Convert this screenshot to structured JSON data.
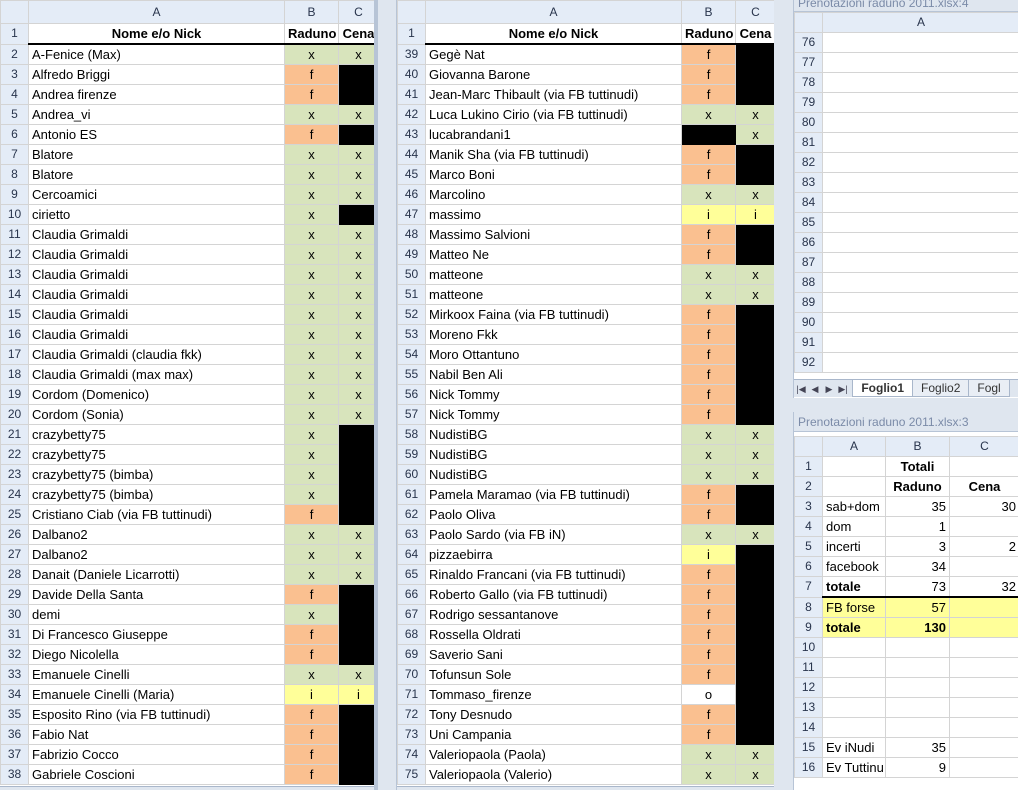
{
  "colors": {
    "green": "#d8e4bc",
    "orange": "#fac090",
    "black": "#000000",
    "yellow": "#ffff99",
    "header": "#e4ecf7"
  },
  "win1": {
    "col_headers": [
      "A",
      "B",
      "C"
    ],
    "header_row": {
      "num": "1",
      "cells": [
        "Nome e/o Nick",
        "Raduno",
        "Cena"
      ]
    },
    "rows": [
      {
        "num": "2",
        "name": "A-Fenice (Max)",
        "b": "x",
        "bc": "g",
        "c": "x",
        "cc": "g"
      },
      {
        "num": "3",
        "name": "Alfredo Briggi",
        "b": "f",
        "bc": "o",
        "c": "",
        "cc": "k"
      },
      {
        "num": "4",
        "name": "Andrea firenze",
        "b": "f",
        "bc": "o",
        "c": "",
        "cc": "k"
      },
      {
        "num": "5",
        "name": "Andrea_vi",
        "b": "x",
        "bc": "g",
        "c": "x",
        "cc": "g"
      },
      {
        "num": "6",
        "name": "Antonio ES",
        "b": "f",
        "bc": "o",
        "c": "",
        "cc": "k"
      },
      {
        "num": "7",
        "name": "Blatore",
        "b": "x",
        "bc": "g",
        "c": "x",
        "cc": "g"
      },
      {
        "num": "8",
        "name": "Blatore",
        "b": "x",
        "bc": "g",
        "c": "x",
        "cc": "g"
      },
      {
        "num": "9",
        "name": "Cercoamici",
        "b": "x",
        "bc": "g",
        "c": "x",
        "cc": "g"
      },
      {
        "num": "10",
        "name": "cirietto",
        "b": "x",
        "bc": "g",
        "c": "",
        "cc": "k"
      },
      {
        "num": "11",
        "name": "Claudia Grimaldi",
        "b": "x",
        "bc": "g",
        "c": "x",
        "cc": "g"
      },
      {
        "num": "12",
        "name": "Claudia Grimaldi",
        "b": "x",
        "bc": "g",
        "c": "x",
        "cc": "g"
      },
      {
        "num": "13",
        "name": "Claudia Grimaldi",
        "b": "x",
        "bc": "g",
        "c": "x",
        "cc": "g"
      },
      {
        "num": "14",
        "name": "Claudia Grimaldi",
        "b": "x",
        "bc": "g",
        "c": "x",
        "cc": "g"
      },
      {
        "num": "15",
        "name": "Claudia Grimaldi",
        "b": "x",
        "bc": "g",
        "c": "x",
        "cc": "g"
      },
      {
        "num": "16",
        "name": "Claudia Grimaldi",
        "b": "x",
        "bc": "g",
        "c": "x",
        "cc": "g"
      },
      {
        "num": "17",
        "name": "Claudia Grimaldi (claudia fkk)",
        "b": "x",
        "bc": "g",
        "c": "x",
        "cc": "g"
      },
      {
        "num": "18",
        "name": "Claudia Grimaldi (max max)",
        "b": "x",
        "bc": "g",
        "c": "x",
        "cc": "g"
      },
      {
        "num": "19",
        "name": "Cordom (Domenico)",
        "b": "x",
        "bc": "g",
        "c": "x",
        "cc": "g"
      },
      {
        "num": "20",
        "name": "Cordom (Sonia)",
        "b": "x",
        "bc": "g",
        "c": "x",
        "cc": "g"
      },
      {
        "num": "21",
        "name": "crazybetty75",
        "b": "x",
        "bc": "g",
        "c": "",
        "cc": "k"
      },
      {
        "num": "22",
        "name": "crazybetty75",
        "b": "x",
        "bc": "g",
        "c": "",
        "cc": "k"
      },
      {
        "num": "23",
        "name": "crazybetty75 (bimba)",
        "b": "x",
        "bc": "g",
        "c": "",
        "cc": "k"
      },
      {
        "num": "24",
        "name": "crazybetty75 (bimba)",
        "b": "x",
        "bc": "g",
        "c": "",
        "cc": "k"
      },
      {
        "num": "25",
        "name": "Cristiano Ciab (via FB tuttinudi)",
        "b": "f",
        "bc": "o",
        "c": "",
        "cc": "k"
      },
      {
        "num": "26",
        "name": "Dalbano2",
        "b": "x",
        "bc": "g",
        "c": "x",
        "cc": "g"
      },
      {
        "num": "27",
        "name": "Dalbano2",
        "b": "x",
        "bc": "g",
        "c": "x",
        "cc": "g"
      },
      {
        "num": "28",
        "name": "Danait (Daniele Licarrotti)",
        "b": "x",
        "bc": "g",
        "c": "x",
        "cc": "g"
      },
      {
        "num": "29",
        "name": "Davide Della Santa",
        "b": "f",
        "bc": "o",
        "c": "",
        "cc": "k"
      },
      {
        "num": "30",
        "name": "demi",
        "b": "x",
        "bc": "g",
        "c": "",
        "cc": "k"
      },
      {
        "num": "31",
        "name": "Di Francesco Giuseppe",
        "b": "f",
        "bc": "o",
        "c": "",
        "cc": "k"
      },
      {
        "num": "32",
        "name": "Diego Nicolella",
        "b": "f",
        "bc": "o",
        "c": "",
        "cc": "k"
      },
      {
        "num": "33",
        "name": "Emanuele Cinelli",
        "b": "x",
        "bc": "g",
        "c": "x",
        "cc": "g"
      },
      {
        "num": "34",
        "name": "Emanuele Cinelli (Maria)",
        "b": "i",
        "bc": "y",
        "c": "i",
        "cc": "y"
      },
      {
        "num": "35",
        "name": "Esposito Rino (via FB tuttinudi)",
        "b": "f",
        "bc": "o",
        "c": "",
        "cc": "k"
      },
      {
        "num": "36",
        "name": "Fabio Nat",
        "b": "f",
        "bc": "o",
        "c": "",
        "cc": "k"
      },
      {
        "num": "37",
        "name": "Fabrizio Cocco",
        "b": "f",
        "bc": "o",
        "c": "",
        "cc": "k"
      },
      {
        "num": "38",
        "name": "Gabriele Coscioni",
        "b": "f",
        "bc": "o",
        "c": "",
        "cc": "k"
      }
    ]
  },
  "win2": {
    "col_headers": [
      "A",
      "B",
      "C"
    ],
    "header_row": {
      "num": "1",
      "cells": [
        "Nome e/o Nick",
        "Raduno",
        "Cena"
      ]
    },
    "rows": [
      {
        "num": "39",
        "name": "Gegè Nat",
        "b": "f",
        "bc": "o",
        "c": "",
        "cc": "k"
      },
      {
        "num": "40",
        "name": "Giovanna Barone",
        "b": "f",
        "bc": "o",
        "c": "",
        "cc": "k"
      },
      {
        "num": "41",
        "name": "Jean-Marc Thibault (via FB tuttinudi)",
        "b": "f",
        "bc": "o",
        "c": "",
        "cc": "k"
      },
      {
        "num": "42",
        "name": "Luca Lukino Cirio (via FB tuttinudi)",
        "b": "x",
        "bc": "g",
        "c": "x",
        "cc": "g"
      },
      {
        "num": "43",
        "name": "lucabrandani1",
        "b": "",
        "bc": "k",
        "c": "x",
        "cc": "g"
      },
      {
        "num": "44",
        "name": "Manik Sha (via FB tuttinudi)",
        "b": "f",
        "bc": "o",
        "c": "",
        "cc": "k"
      },
      {
        "num": "45",
        "name": "Marco Boni",
        "b": "f",
        "bc": "o",
        "c": "",
        "cc": "k"
      },
      {
        "num": "46",
        "name": "Marcolino",
        "b": "x",
        "bc": "g",
        "c": "x",
        "cc": "g"
      },
      {
        "num": "47",
        "name": "massimo",
        "b": "i",
        "bc": "y",
        "c": "i",
        "cc": "y"
      },
      {
        "num": "48",
        "name": "Massimo Salvioni",
        "b": "f",
        "bc": "o",
        "c": "",
        "cc": "k"
      },
      {
        "num": "49",
        "name": "Matteo Ne",
        "b": "f",
        "bc": "o",
        "c": "",
        "cc": "k"
      },
      {
        "num": "50",
        "name": "matteone",
        "b": "x",
        "bc": "g",
        "c": "x",
        "cc": "g"
      },
      {
        "num": "51",
        "name": "matteone",
        "b": "x",
        "bc": "g",
        "c": "x",
        "cc": "g"
      },
      {
        "num": "52",
        "name": "Mirkoox Faina (via FB tuttinudi)",
        "b": "f",
        "bc": "o",
        "c": "",
        "cc": "k"
      },
      {
        "num": "53",
        "name": "Moreno Fkk",
        "b": "f",
        "bc": "o",
        "c": "",
        "cc": "k"
      },
      {
        "num": "54",
        "name": "Moro Ottantuno",
        "b": "f",
        "bc": "o",
        "c": "",
        "cc": "k"
      },
      {
        "num": "55",
        "name": "Nabil Ben Ali",
        "b": "f",
        "bc": "o",
        "c": "",
        "cc": "k"
      },
      {
        "num": "56",
        "name": "Nick Tommy",
        "b": "f",
        "bc": "o",
        "c": "",
        "cc": "k"
      },
      {
        "num": "57",
        "name": "Nick Tommy",
        "b": "f",
        "bc": "o",
        "c": "",
        "cc": "k"
      },
      {
        "num": "58",
        "name": "NudistiBG",
        "b": "x",
        "bc": "g",
        "c": "x",
        "cc": "g"
      },
      {
        "num": "59",
        "name": "NudistiBG",
        "b": "x",
        "bc": "g",
        "c": "x",
        "cc": "g"
      },
      {
        "num": "60",
        "name": "NudistiBG",
        "b": "x",
        "bc": "g",
        "c": "x",
        "cc": "g"
      },
      {
        "num": "61",
        "name": "Pamela Maramao (via FB tuttinudi)",
        "b": "f",
        "bc": "o",
        "c": "",
        "cc": "k"
      },
      {
        "num": "62",
        "name": "Paolo Oliva",
        "b": "f",
        "bc": "o",
        "c": "",
        "cc": "k"
      },
      {
        "num": "63",
        "name": "Paolo Sardo (via FB iN)",
        "b": "x",
        "bc": "g",
        "c": "x",
        "cc": "g"
      },
      {
        "num": "64",
        "name": "pizzaebirra",
        "b": "i",
        "bc": "y",
        "c": "",
        "cc": "k"
      },
      {
        "num": "65",
        "name": "Rinaldo Francani (via FB tuttinudi)",
        "b": "f",
        "bc": "o",
        "c": "",
        "cc": "k"
      },
      {
        "num": "66",
        "name": "Roberto Gallo (via FB tuttinudi)",
        "b": "f",
        "bc": "o",
        "c": "",
        "cc": "k"
      },
      {
        "num": "67",
        "name": "Rodrigo sessantanove",
        "b": "f",
        "bc": "o",
        "c": "",
        "cc": "k"
      },
      {
        "num": "68",
        "name": "Rossella Oldrati",
        "b": "f",
        "bc": "o",
        "c": "",
        "cc": "k"
      },
      {
        "num": "69",
        "name": "Saverio Sani",
        "b": "f",
        "bc": "o",
        "c": "",
        "cc": "k"
      },
      {
        "num": "70",
        "name": "Tofunsun Sole",
        "b": "f",
        "bc": "o",
        "c": "",
        "cc": "k"
      },
      {
        "num": "71",
        "name": "Tommaso_firenze",
        "b": "o",
        "bc": "w",
        "c": "",
        "cc": "k"
      },
      {
        "num": "72",
        "name": "Tony Desnudo",
        "b": "f",
        "bc": "o",
        "c": "",
        "cc": "k"
      },
      {
        "num": "73",
        "name": "Uni Campania",
        "b": "f",
        "bc": "o",
        "c": "",
        "cc": "k"
      },
      {
        "num": "74",
        "name": "Valeriopaola (Paola)",
        "b": "x",
        "bc": "g",
        "c": "x",
        "cc": "g"
      },
      {
        "num": "75",
        "name": "Valeriopaola (Valerio)",
        "b": "x",
        "bc": "g",
        "c": "x",
        "cc": "g"
      }
    ]
  },
  "win3": {
    "title": "Prenotazioni raduno 2011.xlsx:4",
    "col_header": "A",
    "rows": [
      "76",
      "77",
      "78",
      "79",
      "80",
      "81",
      "82",
      "83",
      "84",
      "85",
      "86",
      "87",
      "88",
      "89",
      "90",
      "91",
      "92"
    ],
    "tabs": [
      "Foglio1",
      "Foglio2",
      "Fogl"
    ],
    "active_tab": "Foglio1"
  },
  "win4": {
    "title": "Prenotazioni raduno 2011.xlsx:3",
    "col_headers": [
      "A",
      "B",
      "C"
    ],
    "rows": [
      {
        "num": "1",
        "a": "",
        "b": "Totali",
        "c": ""
      },
      {
        "num": "2",
        "a": "",
        "b": "Raduno",
        "c": "Cena"
      },
      {
        "num": "3",
        "a": "sab+dom",
        "b": "35",
        "c": "30"
      },
      {
        "num": "4",
        "a": "dom",
        "b": "1",
        "c": ""
      },
      {
        "num": "5",
        "a": "incerti",
        "b": "3",
        "c": "2"
      },
      {
        "num": "6",
        "a": "facebook",
        "b": "34",
        "c": ""
      },
      {
        "num": "7",
        "a": "totale",
        "b": "73",
        "c": "32"
      },
      {
        "num": "8",
        "a": "FB forse",
        "b": "57",
        "c": ""
      },
      {
        "num": "9",
        "a": "totale",
        "b": "130",
        "c": ""
      },
      {
        "num": "10",
        "a": "",
        "b": "",
        "c": ""
      },
      {
        "num": "11",
        "a": "",
        "b": "",
        "c": ""
      },
      {
        "num": "12",
        "a": "",
        "b": "",
        "c": ""
      },
      {
        "num": "13",
        "a": "",
        "b": "",
        "c": ""
      },
      {
        "num": "14",
        "a": "",
        "b": "",
        "c": ""
      },
      {
        "num": "15",
        "a": "Ev iNudi",
        "b": "35",
        "c": ""
      },
      {
        "num": "16",
        "a": "Ev Tuttinu",
        "b": "9",
        "c": ""
      }
    ]
  }
}
